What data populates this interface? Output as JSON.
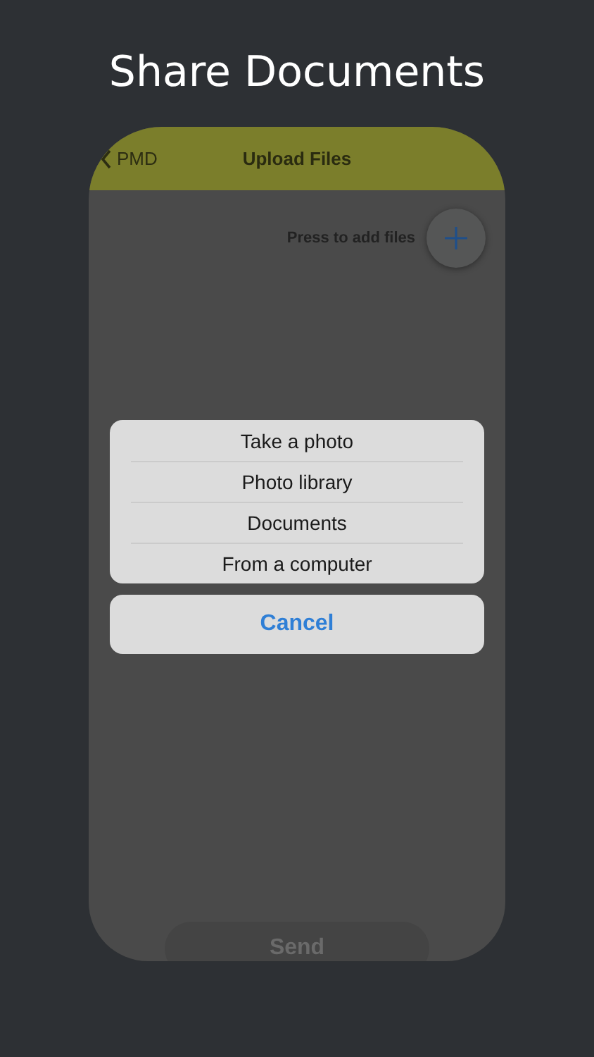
{
  "headline": "Share Documents",
  "nav": {
    "back_label": "PMD",
    "title": "Upload Files"
  },
  "add_hint": "Press to add files",
  "action_sheet": {
    "options": [
      "Take a photo",
      "Photo library",
      "Documents",
      "From a computer"
    ],
    "cancel": "Cancel"
  },
  "send_button": "Send"
}
